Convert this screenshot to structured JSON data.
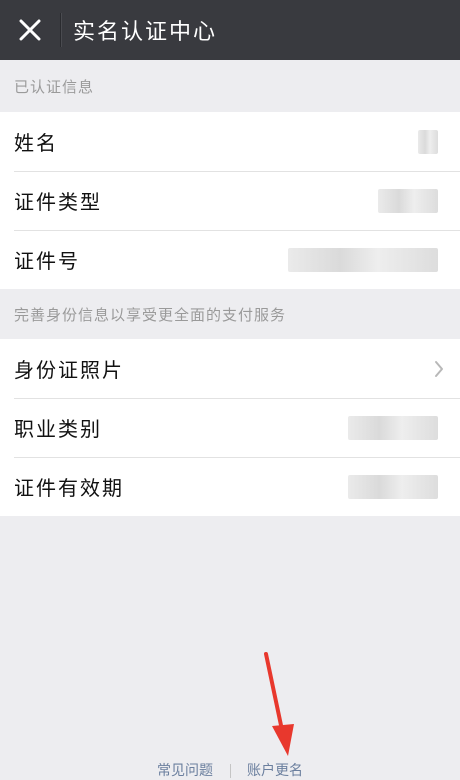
{
  "header": {
    "title": "实名认证中心",
    "close_icon": "close-icon"
  },
  "sections": [
    {
      "title": "已认证信息",
      "items": [
        {
          "label": "姓名"
        },
        {
          "label": "证件类型"
        },
        {
          "label": "证件号"
        }
      ]
    },
    {
      "title": "完善身份信息以享受更全面的支付服务",
      "items": [
        {
          "label": "身份证照片",
          "icon": "chevron-right-icon"
        },
        {
          "label": "职业类别"
        },
        {
          "label": "证件有效期"
        }
      ]
    }
  ],
  "footer": {
    "links": [
      "常见问题",
      "账户更名"
    ]
  },
  "colors": {
    "topbar": "#393a3f",
    "background": "#ededf0",
    "link": "#6b7f9e",
    "annotation_arrow": "#e8382d"
  }
}
